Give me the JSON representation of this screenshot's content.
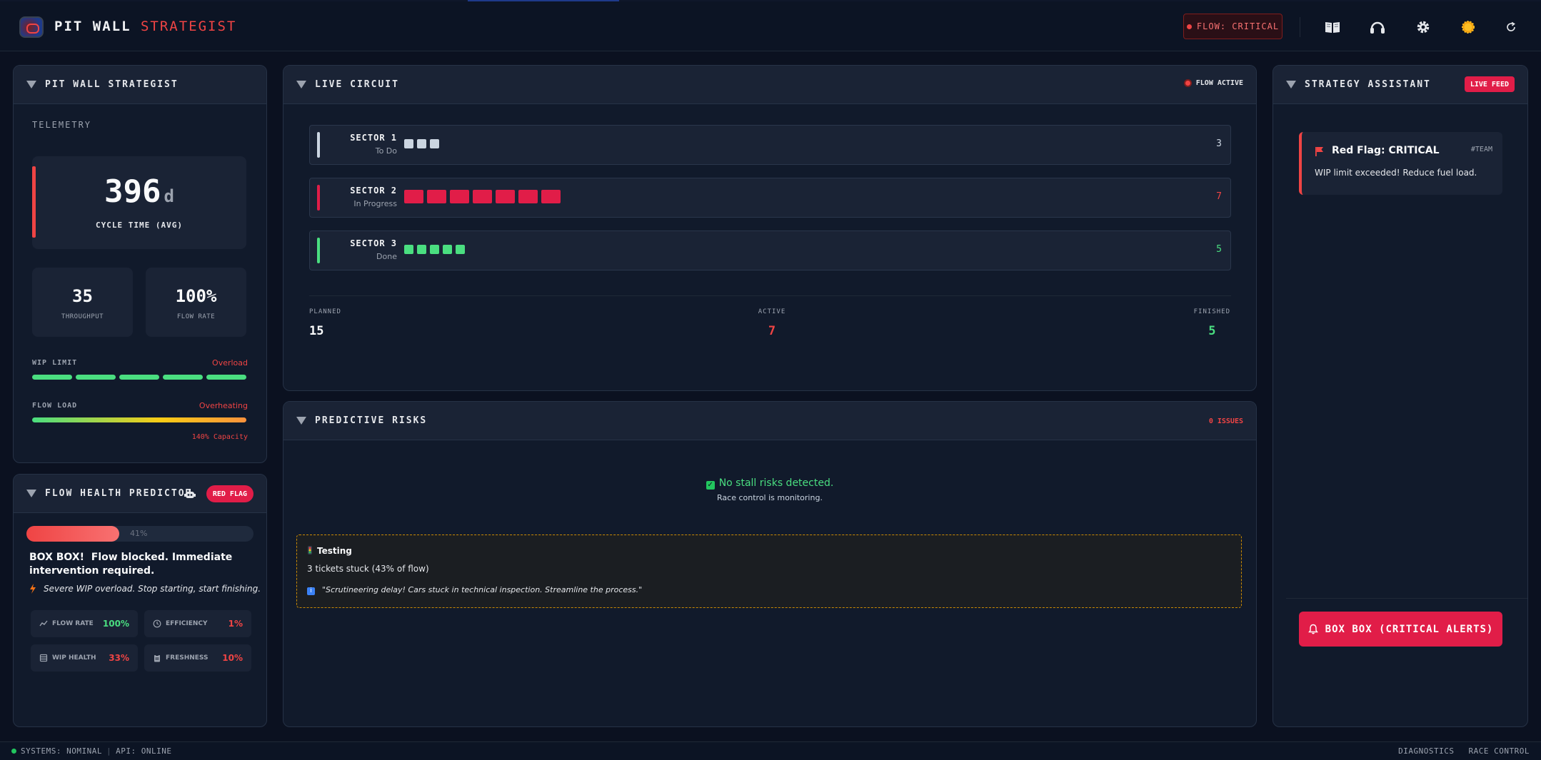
{
  "header": {
    "brand_main": "PIT WALL",
    "brand_accent": "STRATEGIST",
    "flow_status": "FLOW: CRITICAL",
    "icons": [
      "book-icon",
      "headphones-icon",
      "gear-icon",
      "sun-icon",
      "refresh-icon"
    ]
  },
  "left_panel": {
    "title": "PIT WALL STRATEGIST",
    "telemetry_label": "TELEMETRY",
    "cycle_time": "396",
    "cycle_unit": "d",
    "cycle_label": "CYCLE TIME (AVG)",
    "throughput": "35",
    "throughput_label": "THROUGHPUT",
    "flow_rate": "100%",
    "flow_rate_label": "FLOW RATE",
    "wip_label": "WIP LIMIT",
    "wip_status": "Overload",
    "wip_segments": 5,
    "load_label": "FLOW LOAD",
    "load_status": "Overheating",
    "capacity": "140% Capacity"
  },
  "flow_health": {
    "title": "FLOW HEALTH PREDICTOR",
    "badge": "RED FLAG",
    "progress_fraction": 0.41,
    "progress_label": "41%",
    "message_strong": "BOX BOX!",
    "message_rest": "Flow blocked. Immediate intervention required.",
    "warning": "Severe WIP overload. Stop starting, start finishing.",
    "metrics": [
      {
        "label": "FLOW RATE",
        "value": "100%",
        "color": "#4ade80",
        "icon": "trend-icon"
      },
      {
        "label": "EFFICIENCY",
        "value": "1%",
        "color": "#ef4444",
        "icon": "clock-icon"
      },
      {
        "label": "WIP HEALTH",
        "value": "33%",
        "color": "#ef4444",
        "icon": "stack-icon"
      },
      {
        "label": "FRESHNESS",
        "value": "10%",
        "color": "#ef4444",
        "icon": "clipboard-icon"
      }
    ]
  },
  "live_circuit": {
    "title": "LIVE CIRCUIT",
    "status": "FLOW ACTIVE",
    "sectors": [
      {
        "name": "SECTOR 1",
        "sub": "To Do",
        "count": "3",
        "color": "#cbd5e1",
        "count_color": "#cbd5e1"
      },
      {
        "name": "SECTOR 2",
        "sub": "In Progress",
        "count": "7",
        "color": "#e11d48",
        "count_color": "#ef4444"
      },
      {
        "name": "SECTOR 3",
        "sub": "Done",
        "count": "5",
        "color": "#4ade80",
        "count_color": "#4ade80"
      }
    ],
    "planned_label": "PLANNED",
    "planned": "15",
    "active_label": "ACTIVE",
    "active": "7",
    "finished_label": "FINISHED",
    "finished": "5"
  },
  "risks": {
    "title": "PREDICTIVE RISKS",
    "issues": "0 ISSUES",
    "no_risk": "No stall risks detected.",
    "monitoring": "Race control is monitoring.",
    "testing_title": "Testing",
    "testing_line": "3 tickets stuck (43% of flow)",
    "testing_quote": "\"Scrutineering delay! Cars stuck in technical inspection. Streamline the process.\""
  },
  "assistant": {
    "title": "STRATEGY ASSISTANT",
    "badge": "LIVE FEED",
    "alert_title": "Red Flag: CRITICAL",
    "alert_tag": "#TEAM",
    "alert_body": "WIP limit exceeded! Reduce fuel load.",
    "button": "BOX BOX (CRITICAL ALERTS)"
  },
  "footer": {
    "systems": "SYSTEMS: NOMINAL",
    "api": "API: ONLINE",
    "diagnostics": "DIAGNOSTICS",
    "race_control": "RACE CONTROL"
  }
}
